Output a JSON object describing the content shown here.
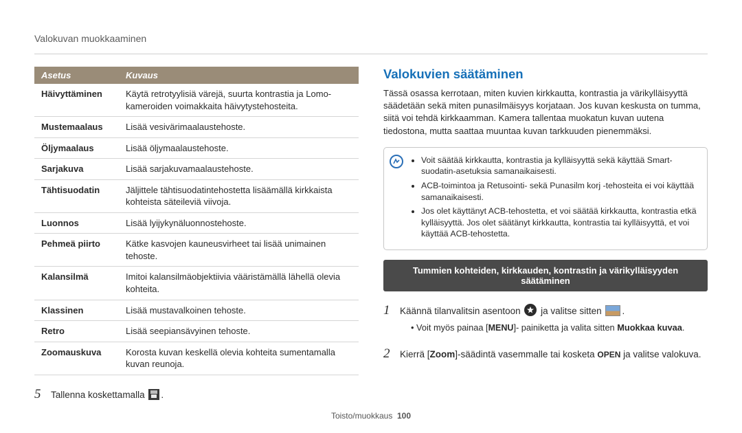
{
  "header": {
    "title": "Valokuvan muokkaaminen"
  },
  "table": {
    "head": {
      "col1": "Asetus",
      "col2": "Kuvaus"
    },
    "rows": [
      {
        "name": "Häivyttäminen",
        "desc": "Käytä retrotyylisiä värejä, suurta kontrastia ja Lomo-kameroiden voimakkaita häivytystehosteita."
      },
      {
        "name": "Mustemaalaus",
        "desc": "Lisää vesivärimaalaustehoste."
      },
      {
        "name": "Öljymaalaus",
        "desc": "Lisää öljymaalaustehoste."
      },
      {
        "name": "Sarjakuva",
        "desc": "Lisää sarjakuvamaalaustehoste."
      },
      {
        "name": "Tähtisuodatin",
        "desc": "Jäljittele tähtisuodatintehostetta lisäämällä kirkkaista kohteista säteileviä viivoja."
      },
      {
        "name": "Luonnos",
        "desc": "Lisää lyijykynäluonnostehoste."
      },
      {
        "name": "Pehmeä piirto",
        "desc": "Kätke kasvojen kauneusvirheet tai lisää unimainen tehoste."
      },
      {
        "name": "Kalansilmä",
        "desc": "Imitoi kalansilmäobjektiivia vääristämällä lähellä olevia kohteita."
      },
      {
        "name": "Klassinen",
        "desc": "Lisää mustavalkoinen tehoste."
      },
      {
        "name": "Retro",
        "desc": "Lisää seepiansävyinen tehoste."
      },
      {
        "name": "Zoomauskuva",
        "desc": "Korosta kuvan keskellä olevia kohteita sumentamalla kuvan reunoja."
      }
    ]
  },
  "step5": {
    "num": "5",
    "pre": "Tallenna koskettamalla ",
    "post": "."
  },
  "right": {
    "title": "Valokuvien säätäminen",
    "intro": "Tässä osassa kerrotaan, miten kuvien kirkkautta, kontrastia ja värikylläisyyttä säädetään sekä miten punasilmäisyys korjataan. Jos kuvan keskusta on tumma, siitä voi tehdä kirkkaamman. Kamera tallentaa muokatun kuvan uutena tiedostona, mutta saattaa muuntaa kuvan tarkkuuden pienemmäksi.",
    "tips": [
      "Voit säätää kirkkautta, kontrastia ja kylläisyyttä sekä käyttää Smart-suodatin-asetuksia samanaikaisesti.",
      "ACB-toimintoa ja Retusointi- sekä Punasilm korj -tehosteita ei voi käyttää samanaikaisesti.",
      "Jos olet käyttänyt ACB-tehostetta, et voi säätää kirkkautta, kontrastia etkä kylläisyyttä. Jos olet säätänyt kirkkautta, kontrastia tai kylläisyyttä, et voi käyttää ACB-tehostetta."
    ],
    "band": "Tummien kohteiden, kirkkauden, kontrastin ja värikylläisyyden säätäminen",
    "step1": {
      "num": "1",
      "pre": "Käännä tilanvalitsin asentoon ",
      "mid": " ja valitse sitten ",
      "post": ".",
      "bullet_pre": "Voit myös painaa [",
      "menu": "MENU",
      "bullet_mid": "]- painiketta ja valita sitten ",
      "bold": "Muokkaa kuvaa",
      "bullet_post": "."
    },
    "step2": {
      "num": "2",
      "a": "Kierrä [",
      "zoom": "Zoom",
      "b": "]-säädintä vasemmalle tai kosketa ",
      "open": "OPEN",
      "c": " ja valitse valokuva."
    }
  },
  "footer": {
    "section": "Toisto/muokkaus",
    "page": "100"
  }
}
